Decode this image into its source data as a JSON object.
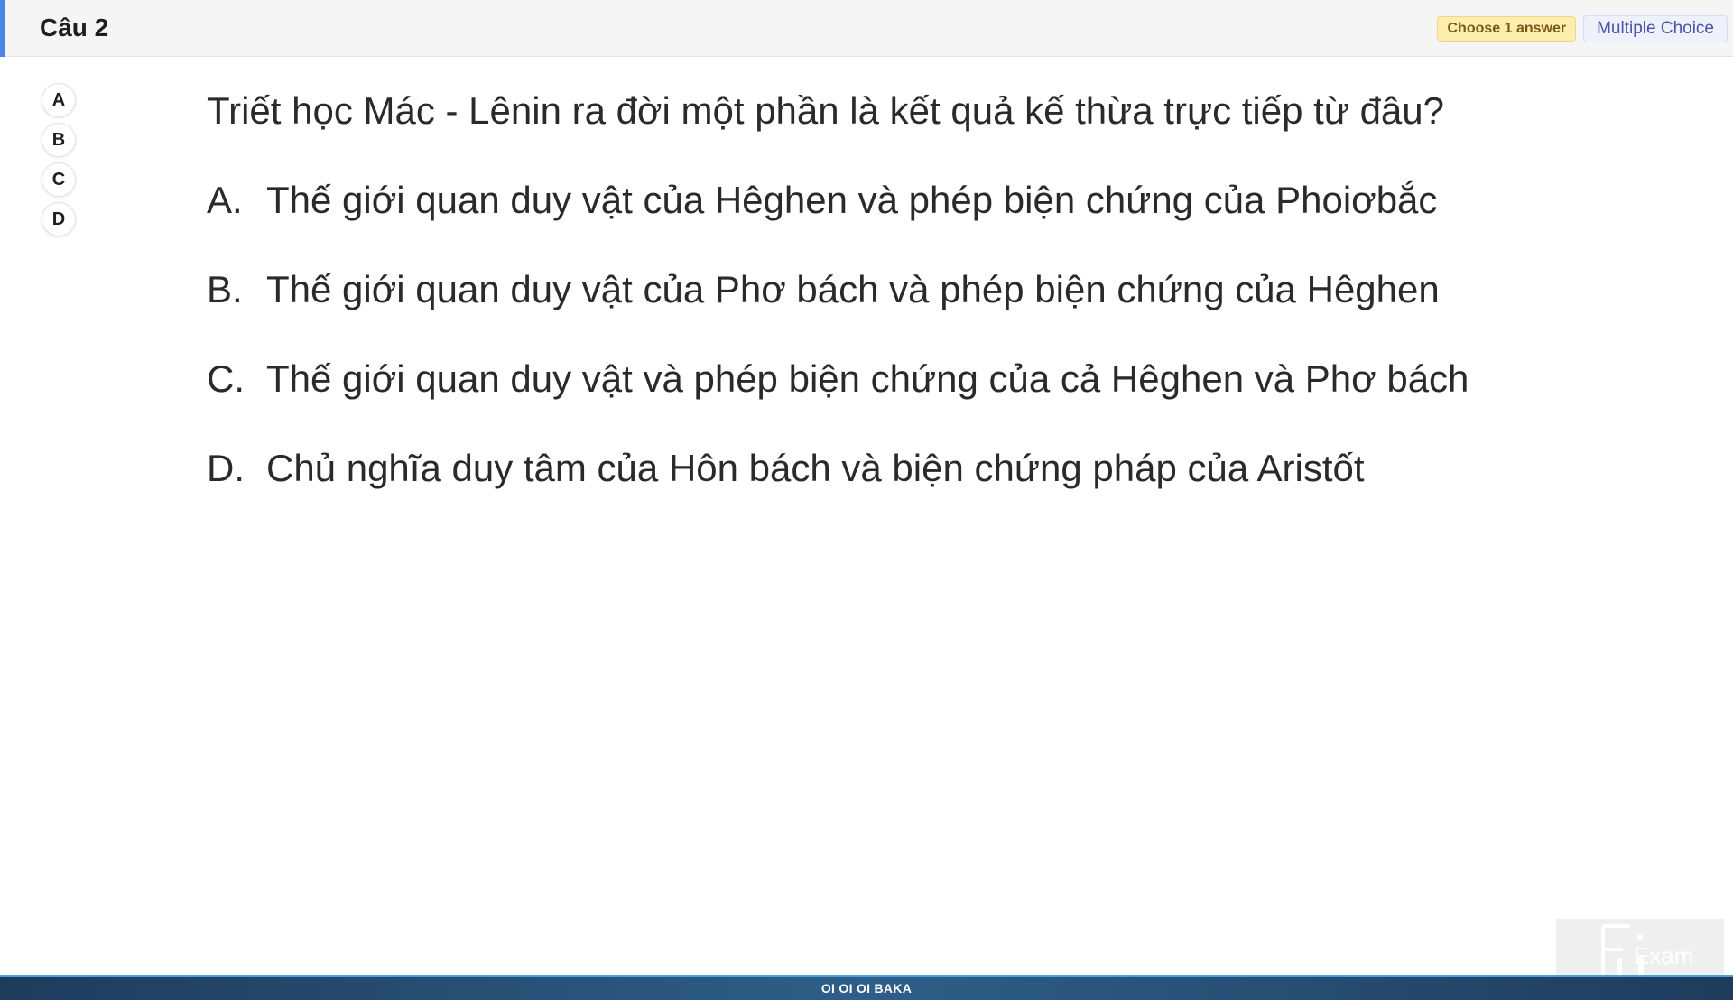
{
  "header": {
    "title": "Câu 2",
    "badge_choose": "Choose 1 answer",
    "badge_type": "Multiple Choice",
    "accent_color": "#4a86e8"
  },
  "options": [
    "A",
    "B",
    "C",
    "D"
  ],
  "question": {
    "stem": "Triết học Mác - Lênin ra đời một phần là kết quả kế thừa trực tiếp từ đâu?",
    "choices": [
      {
        "letter": "A.",
        "text": "Thế giới quan duy vật của Hêghen và phép biện chứng của Phoiơbắc"
      },
      {
        "letter": "B.",
        "text": "Thế giới quan duy vật của Phơ bách và phép biện chứng của Hêghen"
      },
      {
        "letter": "C.",
        "text": "Thế giới quan duy vật và phép biện chứng của cả Hêghen và Phơ bách"
      },
      {
        "letter": "D.",
        "text": "Chủ nghĩa duy tâm của Hôn bách và biện chứng pháp của Aristốt"
      }
    ]
  },
  "watermark": {
    "logo_text": "Exam",
    "logo_icon": "fu-logo-icon"
  },
  "footer": {
    "text": "OI OI OI BAKA",
    "color": "#2e5f88"
  }
}
